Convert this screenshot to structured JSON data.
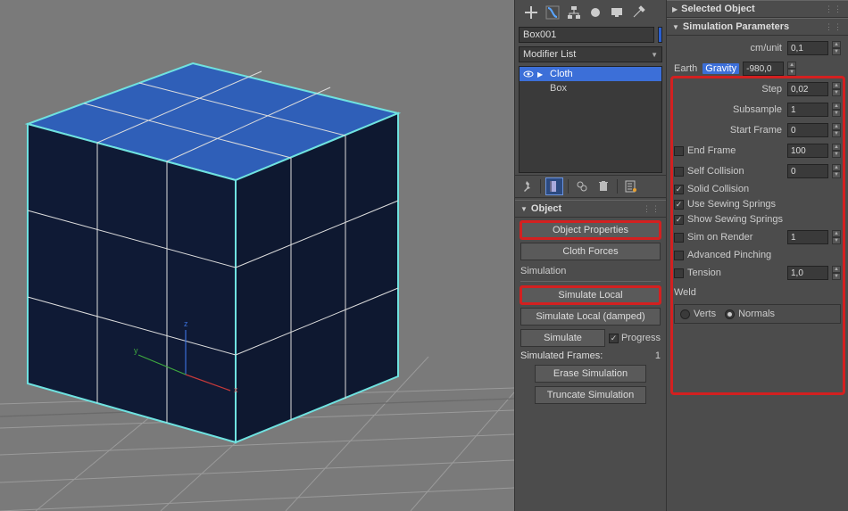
{
  "object": {
    "name": "Box001",
    "modifier_dropdown": "Modifier List",
    "stack": {
      "cloth": "Cloth",
      "box": "Box"
    }
  },
  "rollups": {
    "object": {
      "title": "Object",
      "object_properties": "Object Properties",
      "cloth_forces": "Cloth Forces",
      "simulation_head": "Simulation",
      "simulate_local": "Simulate Local",
      "simulate_local_damped": "Simulate Local (damped)",
      "simulate": "Simulate",
      "progress": "Progress",
      "simulated_frames_lab": "Simulated Frames:",
      "simulated_frames_val": "1",
      "erase_sim": "Erase Simulation",
      "truncate_sim": "Truncate Simulation"
    },
    "selected_object": {
      "title": "Selected Object"
    },
    "sim_params": {
      "title": "Simulation Parameters",
      "cm_unit": {
        "label": "cm/unit",
        "value": "0,1"
      },
      "earth_lab": "Earth",
      "gravity": {
        "label": "Gravity",
        "value": "-980,0"
      },
      "step": {
        "label": "Step",
        "value": "0,02"
      },
      "subsample": {
        "label": "Subsample",
        "value": "1"
      },
      "start_frame": {
        "label": "Start Frame",
        "value": "0"
      },
      "end_frame": {
        "label": "End Frame",
        "value": "100"
      },
      "self_collision": {
        "label": "Self Collision",
        "value": "0"
      },
      "solid_collision": "Solid Collision",
      "use_sewing": "Use Sewing Springs",
      "show_sewing": "Show Sewing Springs",
      "sim_on_render": {
        "label": "Sim on Render",
        "value": "1"
      },
      "adv_pinching": "Advanced Pinching",
      "tension": {
        "label": "Tension",
        "value": "1,0"
      },
      "weld_head": "Weld",
      "weld_verts": "Verts",
      "weld_normals": "Normals"
    }
  }
}
